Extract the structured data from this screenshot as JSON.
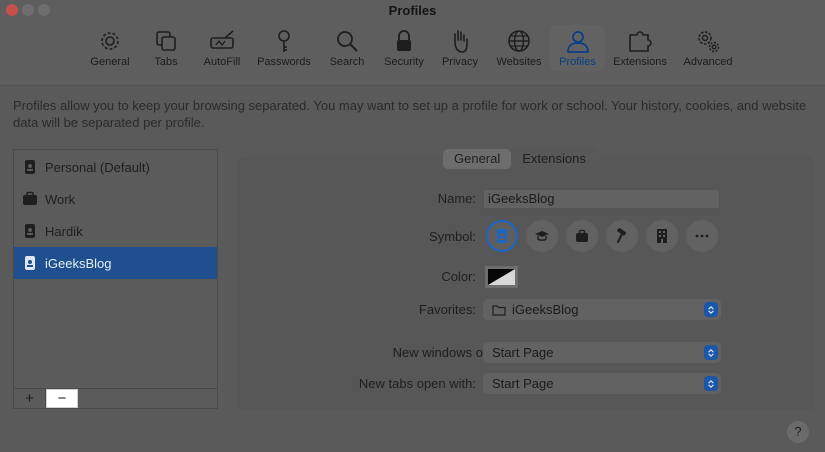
{
  "window": {
    "title": "Profiles"
  },
  "toolbar": {
    "items": [
      {
        "label": "General",
        "icon": "gear-icon"
      },
      {
        "label": "Tabs",
        "icon": "tabs-icon"
      },
      {
        "label": "AutoFill",
        "icon": "autofill-icon"
      },
      {
        "label": "Passwords",
        "icon": "key-icon"
      },
      {
        "label": "Search",
        "icon": "search-icon"
      },
      {
        "label": "Security",
        "icon": "lock-icon"
      },
      {
        "label": "Privacy",
        "icon": "hand-icon"
      },
      {
        "label": "Websites",
        "icon": "globe-icon"
      },
      {
        "label": "Profiles",
        "icon": "person-icon",
        "selected": true
      },
      {
        "label": "Extensions",
        "icon": "puzzle-icon"
      },
      {
        "label": "Advanced",
        "icon": "gears-icon"
      }
    ]
  },
  "description": "Profiles allow you to keep your browsing separated. You may want to set up a profile for work or school. Your history, cookies, and website data will be separated per profile.",
  "profiles": {
    "items": [
      {
        "label": "Personal (Default)",
        "icon": "id-badge-icon"
      },
      {
        "label": "Work",
        "icon": "briefcase-icon"
      },
      {
        "label": "Hardik",
        "icon": "id-badge-icon"
      },
      {
        "label": "iGeeksBlog",
        "icon": "id-badge-icon",
        "selected": true
      }
    ],
    "add_label": "+",
    "remove_label": "−"
  },
  "tabs": {
    "general": "General",
    "extensions": "Extensions",
    "selected": "General"
  },
  "form": {
    "name_label": "Name:",
    "name_value": "iGeeksBlog",
    "symbol_label": "Symbol:",
    "symbols": [
      "id-badge-icon",
      "graduation-cap-icon",
      "briefcase-icon",
      "hammer-icon",
      "building-icon",
      "more-icon"
    ],
    "color_label": "Color:",
    "favorites_label": "Favorites:",
    "favorites_value": "iGeeksBlog",
    "new_windows_label": "New windows open with:",
    "new_windows_value": "Start Page",
    "new_tabs_label": "New tabs open with:",
    "new_tabs_value": "Start Page"
  },
  "help_label": "?",
  "colors": {
    "accent": "#1c56a8",
    "selected_row": "#1f4f8e"
  }
}
